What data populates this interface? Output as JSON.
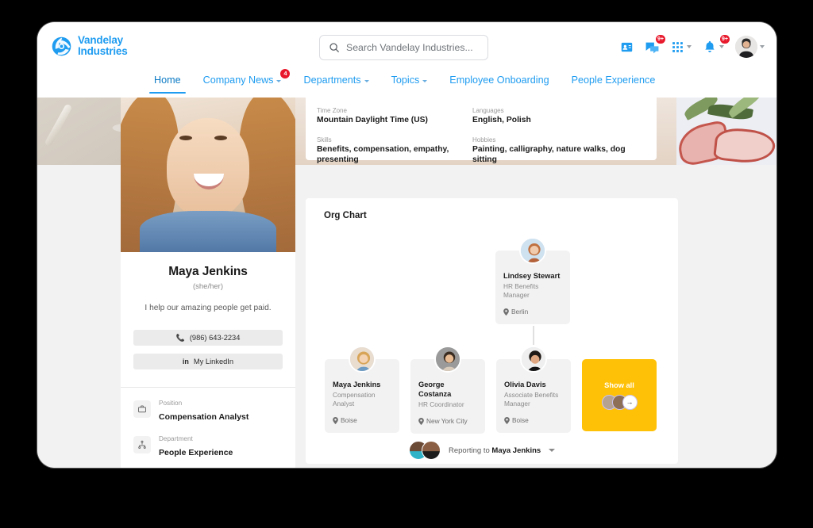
{
  "brand": {
    "logo_icon": "vandelay-globe-icon",
    "name_line1": "Vandelay",
    "name_line2": "Industries",
    "accent_color": "#1f9cf0",
    "badge_color": "#e8192c",
    "highlight_color": "#ffc107"
  },
  "search": {
    "placeholder": "Search Vandelay Industries...",
    "value": "",
    "icon": "search-icon"
  },
  "topbar_actions": [
    {
      "icon": "contact-card-icon",
      "badge": ""
    },
    {
      "icon": "chat-bubbles-icon",
      "badge": "9+"
    },
    {
      "icon": "app-grid-icon",
      "badge": "",
      "caret": true
    },
    {
      "icon": "bell-icon",
      "badge": "9+",
      "caret": true
    },
    {
      "icon": "user-avatar-icon",
      "badge": "",
      "caret": true
    }
  ],
  "nav": {
    "items": [
      {
        "label": "Home",
        "active": true,
        "caret": false,
        "badge": ""
      },
      {
        "label": "Company News",
        "active": false,
        "caret": true,
        "badge": "4"
      },
      {
        "label": "Departments",
        "active": false,
        "caret": true,
        "badge": ""
      },
      {
        "label": "Topics",
        "active": false,
        "caret": true,
        "badge": ""
      },
      {
        "label": "Employee Onboarding",
        "active": false,
        "caret": false,
        "badge": ""
      },
      {
        "label": "People Experience",
        "active": false,
        "caret": false,
        "badge": ""
      }
    ]
  },
  "profile": {
    "photo_alt": "maya-jenkins-portrait",
    "name": "Maya Jenkins",
    "pronouns": "(she/her)",
    "tagline": "I help our amazing people get paid.",
    "phone_label": "(986) 643-2234",
    "phone_icon": "phone-icon",
    "linkedin_label": "My LinkedIn",
    "linkedin_icon": "linkedin-icon",
    "meta": [
      {
        "icon": "briefcase-icon",
        "label": "Position",
        "value": "Compensation Analyst"
      },
      {
        "icon": "org-tree-icon",
        "label": "Department",
        "value": "People Experience"
      }
    ]
  },
  "details": [
    {
      "label": "Time Zone",
      "value": "Mountain Daylight Time (US)"
    },
    {
      "label": "Languages",
      "value": "English, Polish"
    },
    {
      "label": "Skills",
      "value": "Benefits, compensation, empathy, presenting"
    },
    {
      "label": "Hobbies",
      "value": "Painting, calligraphy, nature walks, dog sitting"
    }
  ],
  "org_chart": {
    "title": "Org Chart",
    "manager": {
      "name": "Lindsey Stewart",
      "role": "HR Benefits Manager",
      "location": "Berlin",
      "location_icon": "map-pin-icon",
      "avatar": "lindsey-stewart-avatar"
    },
    "reports": [
      {
        "name": "Maya Jenkins",
        "role": "Compensation Analyst",
        "location": "Boise",
        "location_icon": "map-pin-icon",
        "avatar": "maya-jenkins-avatar"
      },
      {
        "name": "George Costanza",
        "role": "HR Coordinator",
        "location": "New York City",
        "location_icon": "map-pin-icon",
        "avatar": "george-costanza-avatar"
      },
      {
        "name": "Olivia Davis",
        "role": "Associate Benefits Manager",
        "location": "Boise",
        "location_icon": "map-pin-icon",
        "avatar": "olivia-davis-avatar"
      }
    ],
    "show_all": {
      "label": "Show all",
      "arrow_icon": "arrow-right-icon"
    },
    "reporting_to": {
      "prefix": "Reporting to",
      "name": "Maya Jenkins",
      "caret_icon": "chevron-down-icon"
    }
  }
}
